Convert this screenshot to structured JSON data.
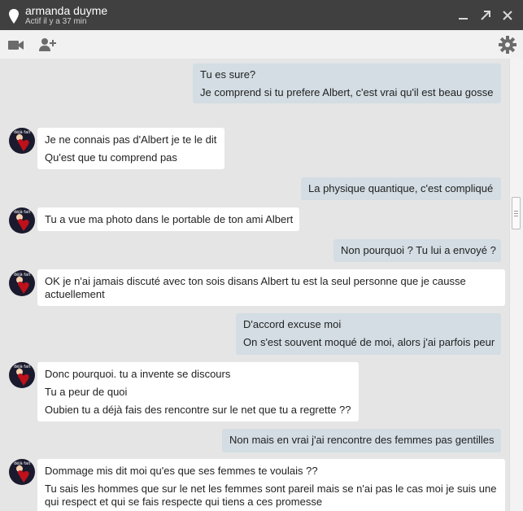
{
  "header": {
    "name": "armanda duyme",
    "status": "Actif il y a 37 min",
    "icons": [
      "location-pin-icon",
      "minimize-icon",
      "popout-icon",
      "close-icon"
    ]
  },
  "toolbar": {
    "icons": [
      "video-call-icon",
      "add-person-icon",
      "settings-icon"
    ]
  },
  "avatar": {
    "label": "déjà fait"
  },
  "messages": [
    {
      "dir": "out",
      "lines": [
        "Tu es sure?",
        "Je comprend si tu prefere Albert, c'est vrai qu'il est beau gosse"
      ]
    },
    {
      "dir": "in",
      "lines": [
        "Je ne connais pas d'Albert je te le dit",
        "Qu'est que tu comprend pas"
      ]
    },
    {
      "dir": "out",
      "lines": [
        "La physique quantique, c'est compliqué"
      ]
    },
    {
      "dir": "in",
      "lines": [
        "Tu a vue ma photo dans le portable de ton ami Albert"
      ]
    },
    {
      "dir": "out",
      "lines": [
        "Non pourquoi ? Tu lui a envoyé ?"
      ]
    },
    {
      "dir": "in",
      "lines": [
        "OK je n'ai jamais discuté avec ton sois disans Albert tu est la seul personne que je causse actuellement"
      ]
    },
    {
      "dir": "out",
      "lines": [
        "D'accord excuse moi",
        "On s'est souvent moqué de moi, alors j'ai parfois peur"
      ]
    },
    {
      "dir": "in",
      "lines": [
        "Donc pourquoi. tu a invente se discours",
        "Tu a peur de quoi",
        "Oubien tu a déjà fais des rencontre sur le net que tu a regrette ??"
      ]
    },
    {
      "dir": "out",
      "lines": [
        "Non mais en vrai j'ai rencontre des femmes pas gentilles"
      ]
    },
    {
      "dir": "in",
      "lines": [
        "Dommage mis dit moi qu'es que ses femmes te voulais ??",
        "Tu sais les hommes que sur le net les femmes sont pareil mais se n'ai pas le cas moi je suis une qui respect et qui se fais respecte qui tiens a ces promesse"
      ]
    }
  ]
}
